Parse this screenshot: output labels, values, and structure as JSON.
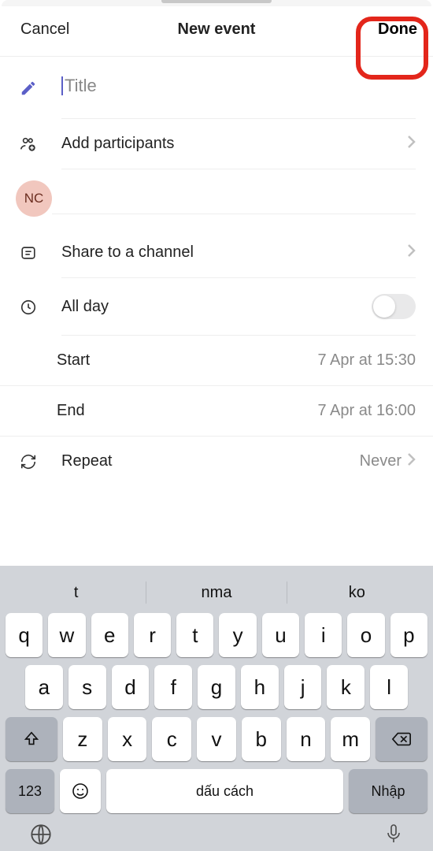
{
  "header": {
    "cancel": "Cancel",
    "title": "New event",
    "done": "Done"
  },
  "form": {
    "title_placeholder": "Title",
    "add_participants": "Add participants",
    "avatar_initials": "NC",
    "share_channel": "Share to a channel",
    "all_day": "All day",
    "start_label": "Start",
    "start_value": "7 Apr at 15:30",
    "end_label": "End",
    "end_value": "7 Apr at 16:00",
    "repeat_label": "Repeat",
    "repeat_value": "Never"
  },
  "keyboard": {
    "suggestions": [
      "t",
      "nma",
      "ko"
    ],
    "row1": [
      "q",
      "w",
      "e",
      "r",
      "t",
      "y",
      "u",
      "i",
      "o",
      "p"
    ],
    "row2": [
      "a",
      "s",
      "d",
      "f",
      "g",
      "h",
      "j",
      "k",
      "l"
    ],
    "row3": [
      "z",
      "x",
      "c",
      "v",
      "b",
      "n",
      "m"
    ],
    "key_123": "123",
    "key_space": "dấu cách",
    "key_enter": "Nhập"
  }
}
